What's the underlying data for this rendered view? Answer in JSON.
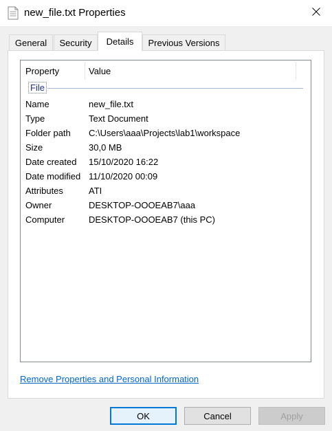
{
  "window": {
    "title": "new_file.txt Properties"
  },
  "tabs": [
    {
      "label": "General",
      "selected": false
    },
    {
      "label": "Security",
      "selected": false
    },
    {
      "label": "Details",
      "selected": true
    },
    {
      "label": "Previous Versions",
      "selected": false
    }
  ],
  "details": {
    "columns": [
      "Property",
      "Value"
    ],
    "group": "File",
    "rows": [
      {
        "property": "Name",
        "value": "new_file.txt"
      },
      {
        "property": "Type",
        "value": "Text Document"
      },
      {
        "property": "Folder path",
        "value": "C:\\Users\\aaa\\Projects\\lab1\\workspace"
      },
      {
        "property": "Size",
        "value": "30,0 MB"
      },
      {
        "property": "Date created",
        "value": "15/10/2020 16:22"
      },
      {
        "property": "Date modified",
        "value": "11/10/2020 00:09"
      },
      {
        "property": "Attributes",
        "value": "ATI"
      },
      {
        "property": "Owner",
        "value": "DESKTOP-OOOEAB7\\aaa"
      },
      {
        "property": "Computer",
        "value": "DESKTOP-OOOEAB7 (this PC)"
      }
    ]
  },
  "link": {
    "label": "Remove Properties and Personal Information"
  },
  "buttons": {
    "ok": "OK",
    "cancel": "Cancel",
    "apply": "Apply"
  },
  "icons": {
    "title": "text-file-icon",
    "close": "close-icon"
  },
  "colors": {
    "link": "#0066cc",
    "default_button_border": "#0078d7",
    "group_header": "#1e3287"
  }
}
